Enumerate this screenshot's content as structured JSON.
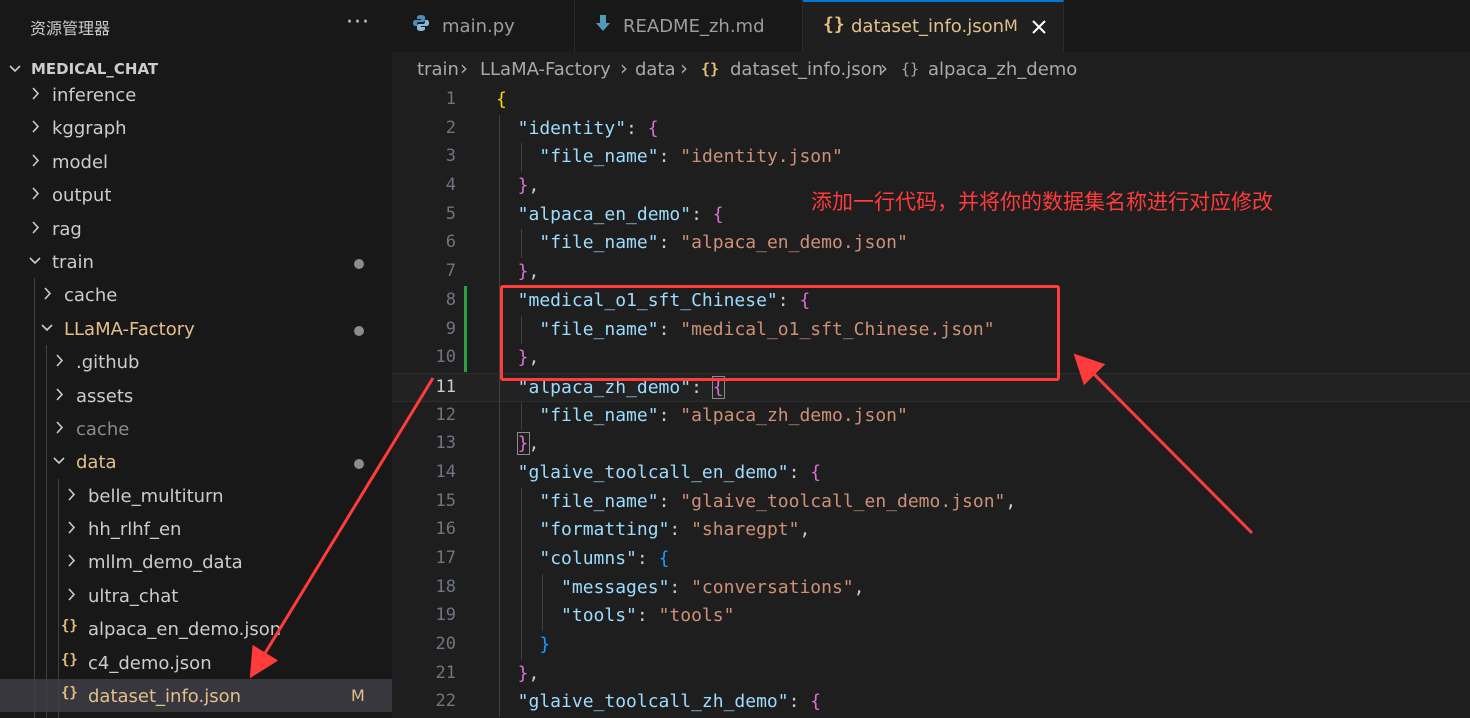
{
  "explorer": {
    "title": "资源管理器",
    "more_icon": "ellipsis-icon",
    "root": "MEDICAL_CHAT",
    "items": [
      {
        "label": "inference",
        "depth": 0,
        "type": "folder",
        "expanded": false
      },
      {
        "label": "kggraph",
        "depth": 0,
        "type": "folder",
        "expanded": false
      },
      {
        "label": "model",
        "depth": 0,
        "type": "folder",
        "expanded": false
      },
      {
        "label": "output",
        "depth": 0,
        "type": "folder",
        "expanded": false
      },
      {
        "label": "rag",
        "depth": 0,
        "type": "folder",
        "expanded": false
      },
      {
        "label": "train",
        "depth": 0,
        "type": "folder",
        "expanded": true,
        "modified_dot": true
      },
      {
        "label": "cache",
        "depth": 1,
        "type": "folder",
        "expanded": false
      },
      {
        "label": "LLaMA-Factory",
        "depth": 1,
        "type": "folder",
        "expanded": true,
        "modified_dot": true,
        "modified": true
      },
      {
        "label": ".github",
        "depth": 2,
        "type": "folder",
        "expanded": false
      },
      {
        "label": "assets",
        "depth": 2,
        "type": "folder",
        "expanded": false
      },
      {
        "label": "cache",
        "depth": 2,
        "type": "folder",
        "expanded": false,
        "dim": true
      },
      {
        "label": "data",
        "depth": 2,
        "type": "folder",
        "expanded": true,
        "modified_dot": true,
        "modified": true
      },
      {
        "label": "belle_multiturn",
        "depth": 3,
        "type": "folder",
        "expanded": false
      },
      {
        "label": "hh_rlhf_en",
        "depth": 3,
        "type": "folder",
        "expanded": false
      },
      {
        "label": "mllm_demo_data",
        "depth": 3,
        "type": "folder",
        "expanded": false
      },
      {
        "label": "ultra_chat",
        "depth": 3,
        "type": "folder",
        "expanded": false
      },
      {
        "label": "alpaca_en_demo.json",
        "depth": 3,
        "type": "json"
      },
      {
        "label": "c4_demo.json",
        "depth": 3,
        "type": "json"
      },
      {
        "label": "dataset_info.json",
        "depth": 3,
        "type": "json",
        "selected": true,
        "modified": true,
        "badge": "M"
      },
      {
        "label": "",
        "depth": 3,
        "type": "json"
      }
    ]
  },
  "tabs": [
    {
      "label": "main.py",
      "icon": "python-icon",
      "active": false
    },
    {
      "label": "README_zh.md",
      "icon": "markdown-icon",
      "active": false
    },
    {
      "label": "dataset_info.json",
      "icon": "json-icon",
      "active": true,
      "modified_badge": "M",
      "close_icon": "close-icon"
    }
  ],
  "breadcrumb": [
    "train",
    "LLaMA-Factory",
    "data",
    "dataset_info.json",
    "alpaca_zh_demo"
  ],
  "editor": {
    "current_line": 11,
    "changed_lines": [
      8,
      9,
      10
    ],
    "lines": [
      {
        "n": "1",
        "indent": 0,
        "tokens": [
          [
            "b1",
            "{"
          ]
        ]
      },
      {
        "n": "2",
        "indent": 1,
        "tokens": [
          [
            "k",
            "\"identity\""
          ],
          [
            "p",
            ": "
          ],
          [
            "b2",
            "{"
          ]
        ]
      },
      {
        "n": "3",
        "indent": 2,
        "tokens": [
          [
            "k",
            "\"file_name\""
          ],
          [
            "p",
            ": "
          ],
          [
            "s",
            "\"identity.json\""
          ]
        ]
      },
      {
        "n": "4",
        "indent": 1,
        "tokens": [
          [
            "b2",
            "}"
          ],
          [
            "p",
            ","
          ]
        ]
      },
      {
        "n": "5",
        "indent": 1,
        "tokens": [
          [
            "k",
            "\"alpaca_en_demo\""
          ],
          [
            "p",
            ": "
          ],
          [
            "b2",
            "{"
          ]
        ]
      },
      {
        "n": "6",
        "indent": 2,
        "tokens": [
          [
            "k",
            "\"file_name\""
          ],
          [
            "p",
            ": "
          ],
          [
            "s",
            "\"alpaca_en_demo.json\""
          ]
        ]
      },
      {
        "n": "7",
        "indent": 1,
        "tokens": [
          [
            "b2",
            "}"
          ],
          [
            "p",
            ","
          ]
        ]
      },
      {
        "n": "8",
        "indent": 1,
        "tokens": [
          [
            "k",
            "\"medical_o1_sft_Chinese\""
          ],
          [
            "p",
            ": "
          ],
          [
            "b2",
            "{"
          ]
        ]
      },
      {
        "n": "9",
        "indent": 2,
        "tokens": [
          [
            "k",
            "\"file_name\""
          ],
          [
            "p",
            ": "
          ],
          [
            "s",
            "\"medical_o1_sft_Chinese.json\""
          ]
        ]
      },
      {
        "n": "10",
        "indent": 1,
        "tokens": [
          [
            "b2",
            "}"
          ],
          [
            "p",
            ","
          ]
        ]
      },
      {
        "n": "11",
        "indent": 1,
        "tokens": [
          [
            "k",
            "\"alpaca_zh_demo\""
          ],
          [
            "p",
            ": "
          ],
          [
            "b2m",
            "{"
          ]
        ]
      },
      {
        "n": "12",
        "indent": 2,
        "tokens": [
          [
            "k",
            "\"file_name\""
          ],
          [
            "p",
            ": "
          ],
          [
            "s",
            "\"alpaca_zh_demo.json\""
          ]
        ]
      },
      {
        "n": "13",
        "indent": 1,
        "tokens": [
          [
            "b2m",
            "}"
          ],
          [
            "p",
            ","
          ]
        ]
      },
      {
        "n": "14",
        "indent": 1,
        "tokens": [
          [
            "k",
            "\"glaive_toolcall_en_demo\""
          ],
          [
            "p",
            ": "
          ],
          [
            "b2",
            "{"
          ]
        ]
      },
      {
        "n": "15",
        "indent": 2,
        "tokens": [
          [
            "k",
            "\"file_name\""
          ],
          [
            "p",
            ": "
          ],
          [
            "s",
            "\"glaive_toolcall_en_demo.json\""
          ],
          [
            "p",
            ","
          ]
        ]
      },
      {
        "n": "16",
        "indent": 2,
        "tokens": [
          [
            "k",
            "\"formatting\""
          ],
          [
            "p",
            ": "
          ],
          [
            "s",
            "\"sharegpt\""
          ],
          [
            "p",
            ","
          ]
        ]
      },
      {
        "n": "17",
        "indent": 2,
        "tokens": [
          [
            "k",
            "\"columns\""
          ],
          [
            "p",
            ": "
          ],
          [
            "b3",
            "{"
          ]
        ]
      },
      {
        "n": "18",
        "indent": 3,
        "tokens": [
          [
            "k",
            "\"messages\""
          ],
          [
            "p",
            ": "
          ],
          [
            "s",
            "\"conversations\""
          ],
          [
            "p",
            ","
          ]
        ]
      },
      {
        "n": "19",
        "indent": 3,
        "tokens": [
          [
            "k",
            "\"tools\""
          ],
          [
            "p",
            ": "
          ],
          [
            "s",
            "\"tools\""
          ]
        ]
      },
      {
        "n": "20",
        "indent": 2,
        "tokens": [
          [
            "b3",
            "}"
          ]
        ]
      },
      {
        "n": "21",
        "indent": 1,
        "tokens": [
          [
            "b2",
            "}"
          ],
          [
            "p",
            ","
          ]
        ]
      },
      {
        "n": "22",
        "indent": 1,
        "tokens": [
          [
            "k",
            "\"glaive_toolcall_zh_demo\""
          ],
          [
            "p",
            ": "
          ],
          [
            "b2",
            "{"
          ]
        ]
      }
    ]
  },
  "annotation": {
    "text": "添加一行代码，并将你的数据集名称进行对应修改",
    "color": "#ff3b3b"
  },
  "colors": {
    "accent": "#0078d4",
    "modified": "#e2c08d",
    "git_added": "#2ea043"
  }
}
